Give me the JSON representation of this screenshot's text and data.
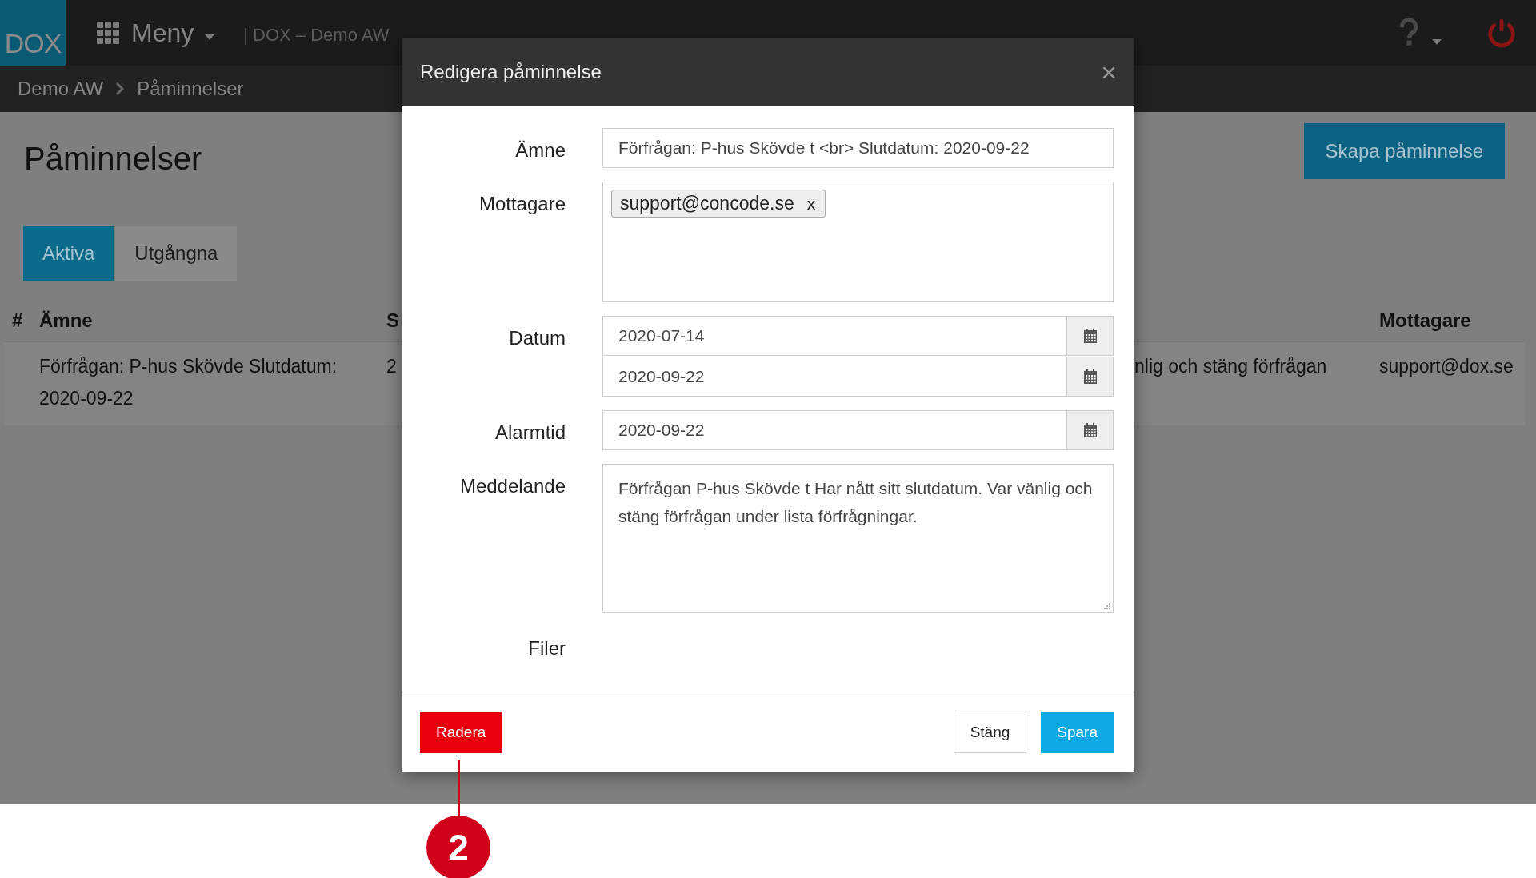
{
  "top_bar": {
    "logo": "DOX",
    "menu_label": "Meny",
    "app_title": "| DOX – Demo AW"
  },
  "breadcrumb": [
    "Demo AW",
    "Påminnelser"
  ],
  "page_title": "Påminnelser",
  "create_button": "Skapa påminnelse",
  "tabs": [
    {
      "label": "Aktiva",
      "selected": true
    },
    {
      "label": "Utgångna",
      "selected": false
    }
  ],
  "table": {
    "columns": [
      "#",
      "Ämne",
      "S",
      "",
      "Mottagare"
    ],
    "rows": [
      {
        "number": "",
        "subject": "Förfrågan: P-hus Skövde Slutdatum: 2020-09-22",
        "column_3": "2",
        "column_4": "nlig och stäng förfrågan",
        "recipient": "support@dox.se"
      }
    ]
  },
  "dialog": {
    "title": "Redigera påminnelse",
    "close": "×",
    "fields": [
      {
        "kind": "text",
        "label": "Ämne",
        "value": "Förfrågan: P-hus Skövde t <br> Slutdatum: 2020-09-22"
      },
      {
        "kind": "tags",
        "label": "Mottagare",
        "tags": [
          {
            "text": "support@concode.se",
            "remove": "x"
          }
        ]
      },
      {
        "kind": "dates",
        "label": "Datum",
        "values": [
          "2020-07-14",
          "2020-09-22"
        ]
      },
      {
        "kind": "dates",
        "label": "Alarmtid",
        "values": [
          "2020-09-22"
        ]
      },
      {
        "kind": "textarea",
        "label": "Meddelande",
        "value": "Förfrågan P-hus Skövde t Har nått sitt slutdatum. Var vänlig och stäng förfrågan under lista förfrågningar."
      },
      {
        "kind": "files",
        "label": "Filer"
      }
    ],
    "buttons": [
      {
        "label": "Radera",
        "kind": "danger"
      },
      {
        "label": "Stäng",
        "kind": "default"
      },
      {
        "label": "Spara",
        "kind": "primary"
      }
    ]
  },
  "callout": {
    "number": "2"
  }
}
